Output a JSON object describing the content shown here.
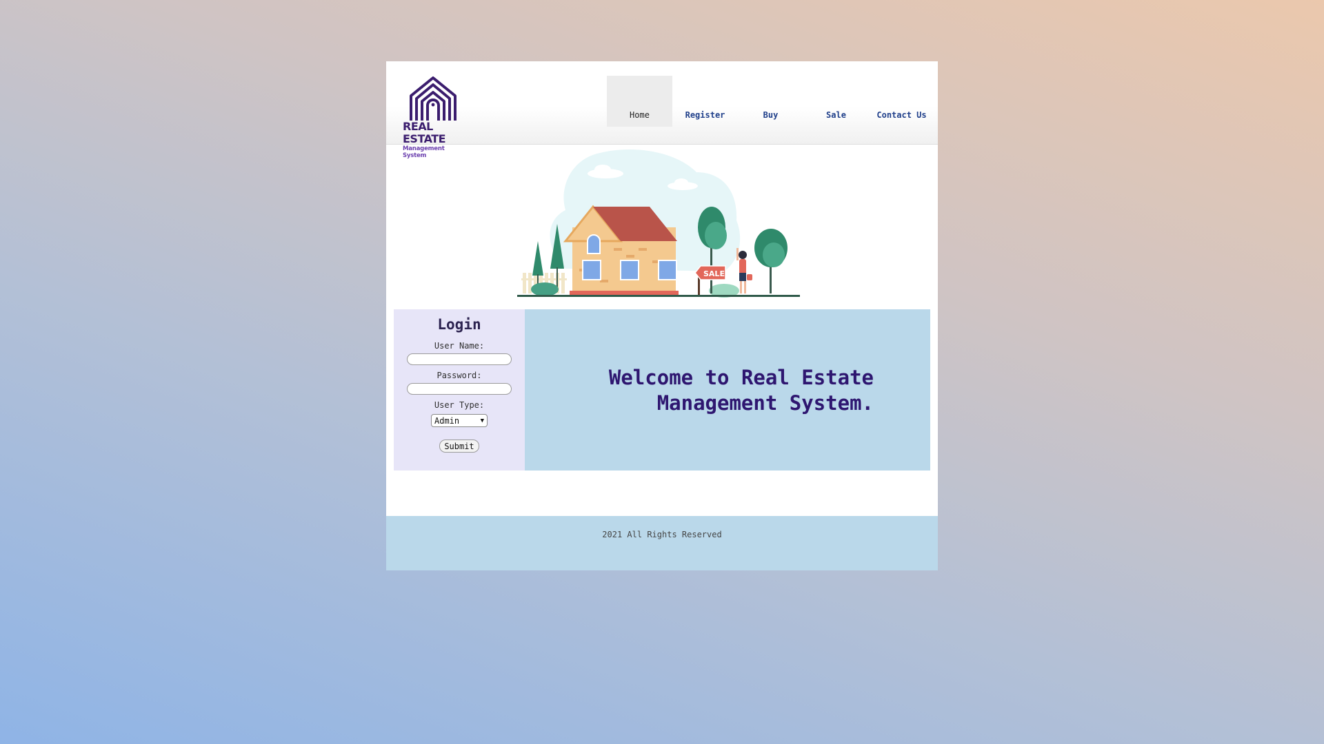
{
  "logo": {
    "title": "REAL ESTATE",
    "subtitle": "Management System",
    "icon": "house-logo-icon",
    "color": "#3b1d6e"
  },
  "nav": {
    "items": [
      {
        "label": "Home",
        "active": true
      },
      {
        "label": "Register",
        "active": false
      },
      {
        "label": "Buy",
        "active": false
      },
      {
        "label": "Sale",
        "active": false
      },
      {
        "label": "Contact Us",
        "active": false
      }
    ]
  },
  "hero": {
    "icon": "house-for-sale-illustration",
    "sign_text": "SALE"
  },
  "login": {
    "title": "Login",
    "username_label": "User Name:",
    "username_value": "",
    "password_label": "Password:",
    "password_value": "",
    "usertype_label": "User Type:",
    "usertype_selected": "Admin",
    "submit_label": "Submit"
  },
  "welcome": {
    "line1": "Welcome to Real Estate",
    "line2": "Management System."
  },
  "footer": {
    "text": "2021 All Rights Reserved"
  },
  "colors": {
    "panel": "#bad8ea",
    "login_bg": "#e7e5f8",
    "accent": "#2e1670"
  }
}
